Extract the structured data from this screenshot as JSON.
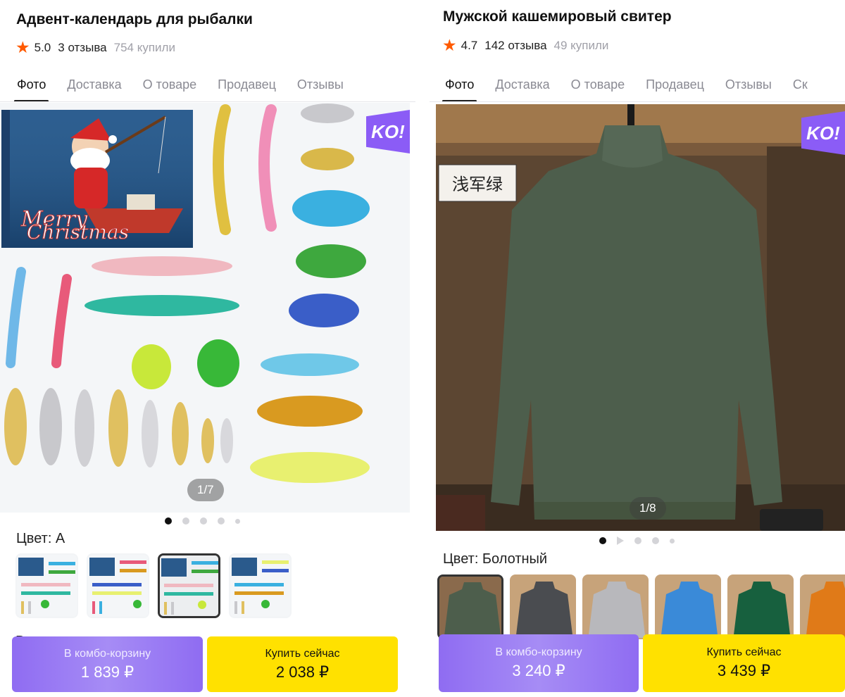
{
  "left": {
    "title": "Адвент-календарь для рыбалки",
    "rating": "5.0",
    "reviews": "3 отзыва",
    "bought": "754 купили",
    "tabs": [
      "Фото",
      "Доставка",
      "О товаре",
      "Продавец",
      "Отзывы"
    ],
    "badge": "KO!",
    "box_text": "Merry Christmas",
    "counter": "1/7",
    "color_label": "Цвет: A",
    "under_text": "В",
    "combo_label": "В комбо-корзину",
    "combo_price": "1 839 ₽",
    "buy_label": "Купить сейчас",
    "buy_price": "2 038 ₽"
  },
  "right": {
    "title": "Мужской кашемировый свитер",
    "rating": "4.7",
    "reviews": "142 отзыва",
    "bought": "49 купили",
    "tabs": [
      "Фото",
      "Доставка",
      "О товаре",
      "Продавец",
      "Отзывы",
      "Ск"
    ],
    "badge": "KO!",
    "photo_caption": "浅军绿",
    "counter": "1/8",
    "color_label": "Цвет: Болотный",
    "combo_label": "В комбо-корзину",
    "combo_price": "3 240 ₽",
    "buy_label": "Купить сейчас",
    "buy_price": "3 439 ₽"
  },
  "colors": {
    "accent_purple": "#8f6cf2",
    "buy_yellow": "#ffe100",
    "star_orange": "#ff5a00"
  }
}
